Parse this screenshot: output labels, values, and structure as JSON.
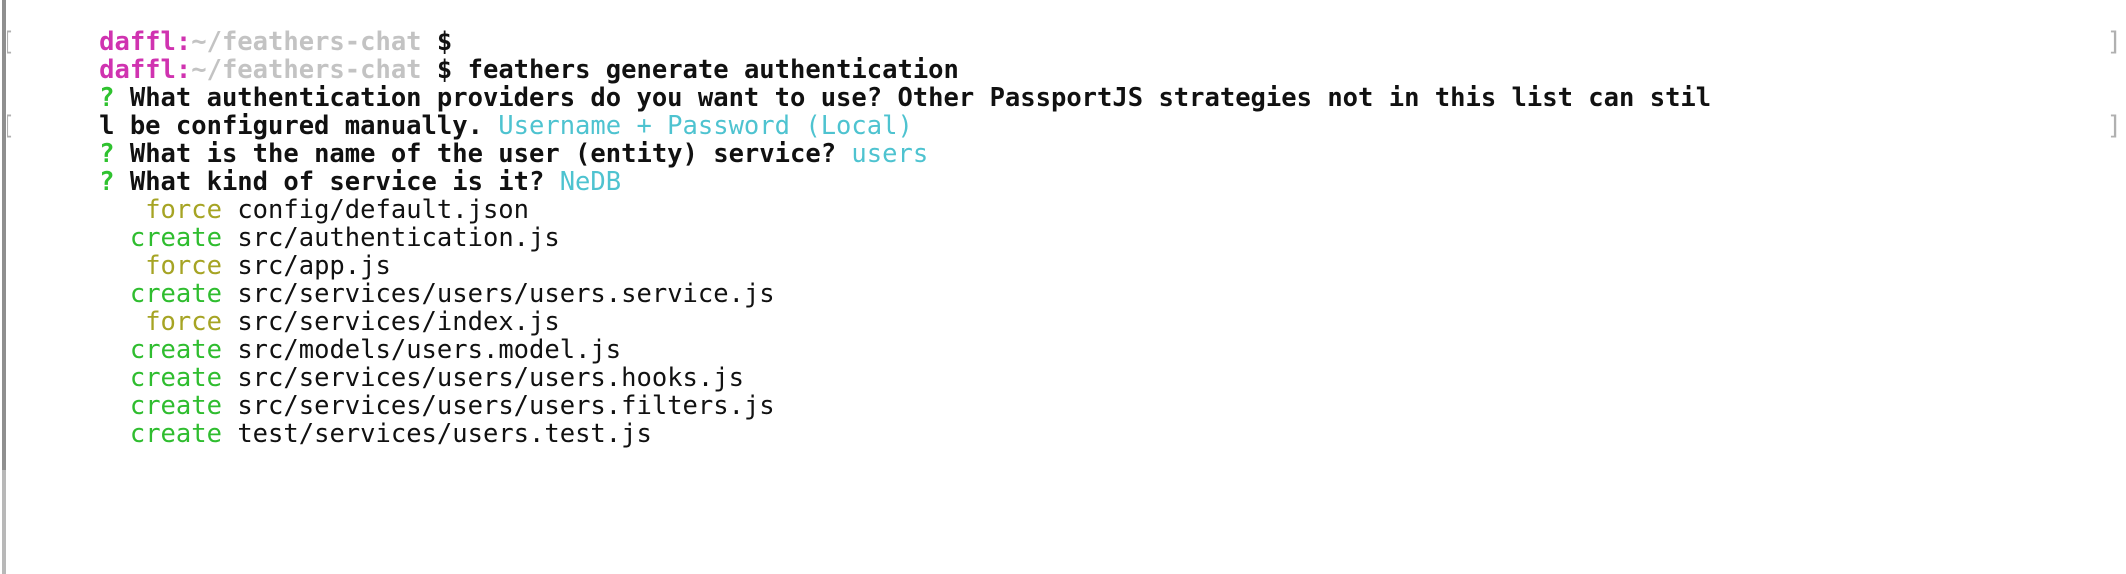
{
  "terminal": {
    "background_color": "#ffffff",
    "foreground_color": "#111111",
    "colors": {
      "user": "#d033b0",
      "path": "#c3c3c3",
      "prompt_symbol": "#111111",
      "question_mark": "#2fc22f",
      "answer": "#4ec3d0",
      "force": "#a6a424",
      "create": "#2fbd2f",
      "bracket_artifact": "#b0b0b0"
    },
    "bracket_left": "[",
    "bracket_right": "]",
    "lines": [
      {
        "type": "prompt",
        "user": "daffl:",
        "path": "~/feathers-chat",
        "symbol": "$",
        "command": ""
      },
      {
        "type": "prompt",
        "user": "daffl:",
        "path": "~/feathers-chat",
        "symbol": "$",
        "command": " feathers generate authentication",
        "bracket_left": true,
        "bracket_right": true
      },
      {
        "type": "question",
        "marker": "?",
        "text": " What authentication providers do you want to use? Other PassportJS strategies not in this list can stil",
        "answer": ""
      },
      {
        "type": "question_wrap",
        "text": "l be configured manually. ",
        "answer": "Username + Password (Local)"
      },
      {
        "type": "question",
        "marker": "?",
        "text": " What is the name of the user (entity) service? ",
        "answer": "users",
        "bracket_left": true,
        "bracket_right": true
      },
      {
        "type": "question",
        "marker": "?",
        "text": " What kind of service is it? ",
        "answer": "NeDB"
      },
      {
        "type": "file",
        "action": "force",
        "path": "config/default.json"
      },
      {
        "type": "file",
        "action": "create",
        "path": "src/authentication.js"
      },
      {
        "type": "file",
        "action": "force",
        "path": "src/app.js"
      },
      {
        "type": "file",
        "action": "create",
        "path": "src/services/users/users.service.js"
      },
      {
        "type": "file",
        "action": "force",
        "path": "src/services/index.js"
      },
      {
        "type": "file",
        "action": "create",
        "path": "src/models/users.model.js"
      },
      {
        "type": "file",
        "action": "create",
        "path": "src/services/users/users.hooks.js"
      },
      {
        "type": "file",
        "action": "create",
        "path": "src/services/users/users.filters.js"
      },
      {
        "type": "file",
        "action": "create",
        "path": "test/services/users.test.js"
      }
    ]
  }
}
